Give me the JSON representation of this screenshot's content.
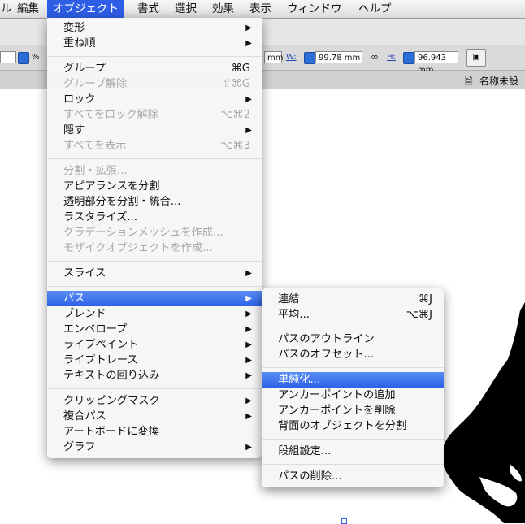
{
  "menubar": {
    "items": [
      {
        "label": "ル"
      },
      {
        "label": "編集"
      },
      {
        "label": "オブジェクト"
      },
      {
        "label": "書式"
      },
      {
        "label": "選択"
      },
      {
        "label": "効果"
      },
      {
        "label": "表示"
      },
      {
        "label": "ウィンドウ"
      },
      {
        "label": "ヘルプ"
      }
    ]
  },
  "control_bar": {
    "percent_sign": "%",
    "x_unit": "mm",
    "w_label": "W:",
    "w_value": "99.78 mm",
    "h_label": "H:",
    "h_value": "96.943 mm"
  },
  "document": {
    "title": "名称未設定"
  },
  "object_menu": {
    "items": [
      {
        "label": "変形"
      },
      {
        "label": "重ね順"
      },
      {
        "label": "グループ",
        "shortcut": "⌘G"
      },
      {
        "label": "グループ解除",
        "shortcut": "⇧⌘G"
      },
      {
        "label": "ロック"
      },
      {
        "label": "すべてをロック解除",
        "shortcut": "⌥⌘2"
      },
      {
        "label": "隠す"
      },
      {
        "label": "すべてを表示",
        "shortcut": "⌥⌘3"
      },
      {
        "label": "分割・拡張..."
      },
      {
        "label": "アピアランスを分割"
      },
      {
        "label": "透明部分を分割・統合..."
      },
      {
        "label": "ラスタライズ..."
      },
      {
        "label": "グラデーションメッシュを作成..."
      },
      {
        "label": "モザイクオブジェクトを作成..."
      },
      {
        "label": "スライス"
      },
      {
        "label": "パス"
      },
      {
        "label": "ブレンド"
      },
      {
        "label": "エンベロープ"
      },
      {
        "label": "ライブペイント"
      },
      {
        "label": "ライブトレース"
      },
      {
        "label": "テキストの回り込み"
      },
      {
        "label": "クリッピングマスク"
      },
      {
        "label": "複合パス"
      },
      {
        "label": "アートボードに変換"
      },
      {
        "label": "グラフ"
      }
    ]
  },
  "path_submenu": {
    "items": [
      {
        "label": "連結",
        "shortcut": "⌘J"
      },
      {
        "label": "平均...",
        "shortcut": "⌥⌘J"
      },
      {
        "label": "パスのアウトライン"
      },
      {
        "label": "パスのオフセット..."
      },
      {
        "label": "単純化..."
      },
      {
        "label": "アンカーポイントの追加"
      },
      {
        "label": "アンカーポイントを削除"
      },
      {
        "label": "背面のオブジェクトを分割"
      },
      {
        "label": "段組設定..."
      },
      {
        "label": "パスの削除..."
      }
    ]
  }
}
